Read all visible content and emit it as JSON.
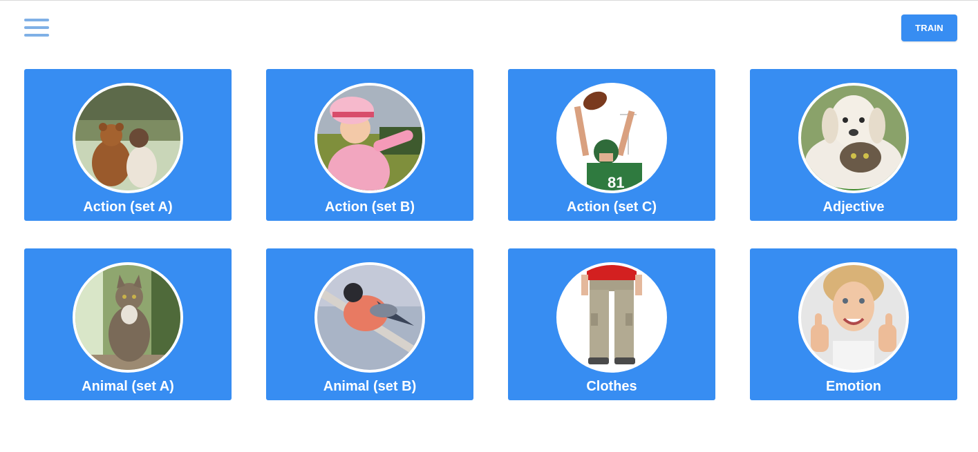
{
  "header": {
    "menu_icon": "hamburger-menu-icon",
    "train_label": "TRAIN"
  },
  "colors": {
    "accent": "#378df2",
    "menu_icon": "#7fb0e6",
    "card_text": "#ffffff"
  },
  "categories": [
    {
      "label": "Action (set A)",
      "image": "teddy-bear-and-child-photo"
    },
    {
      "label": "Action (set B)",
      "image": "girl-pointing-photo"
    },
    {
      "label": "Action (set C)",
      "image": "football-player-catching-photo"
    },
    {
      "label": "Adjective",
      "image": "puppy-and-cat-photo"
    },
    {
      "label": "Animal (set A)",
      "image": "cat-photo"
    },
    {
      "label": "Animal (set B)",
      "image": "bullfinch-bird-photo"
    },
    {
      "label": "Clothes",
      "image": "cargo-pants-photo"
    },
    {
      "label": "Emotion",
      "image": "girl-thumbs-up-photo"
    }
  ]
}
